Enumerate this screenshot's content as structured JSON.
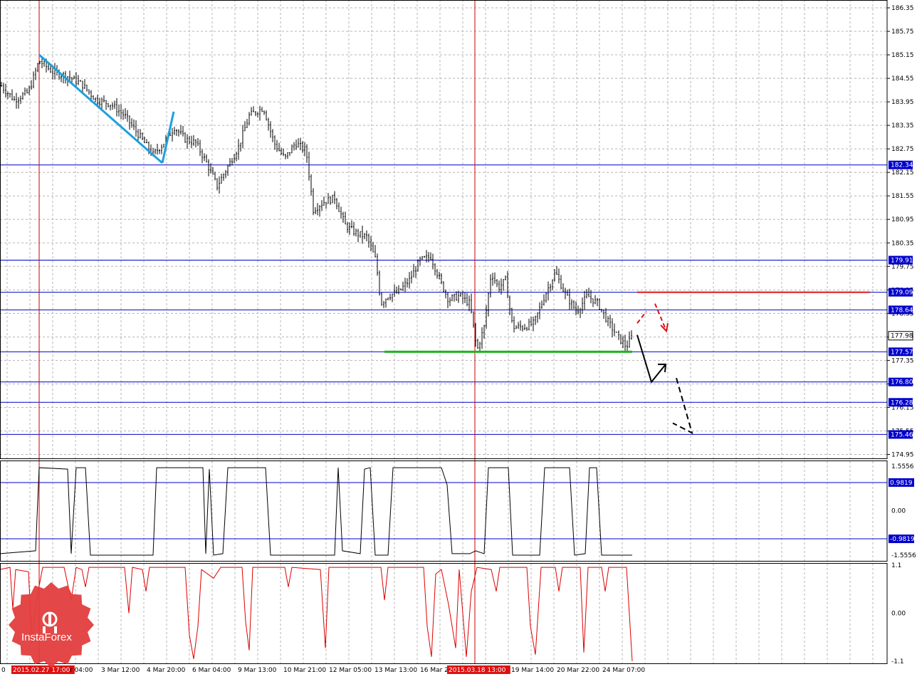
{
  "chart_data": {
    "type": "candlestick",
    "main_panel": {
      "price_scale": [
        186.35,
        185.75,
        185.15,
        184.55,
        183.95,
        183.35,
        182.75,
        182.15,
        181.55,
        180.95,
        180.35,
        179.75,
        179.15,
        178.55,
        177.95,
        177.35,
        176.75,
        176.15,
        175.55,
        174.95
      ],
      "ylim": [
        174.85,
        186.55
      ],
      "levels": [
        {
          "value": 182.34,
          "label": "182.34"
        },
        {
          "value": 179.91,
          "label": "179.91"
        },
        {
          "value": 179.09,
          "label": "179.09"
        },
        {
          "value": 178.64,
          "label": "178.64"
        },
        {
          "value": 177.57,
          "label": "177.57"
        },
        {
          "value": 176.8,
          "label": "176.80"
        },
        {
          "value": 176.28,
          "label": "176.28"
        },
        {
          "value": 175.46,
          "label": "175.46"
        }
      ],
      "current_price": "177.98",
      "close_path": [
        [
          0,
          184.4
        ],
        [
          20,
          184.0
        ],
        [
          40,
          184.2
        ],
        [
          55,
          185.0
        ],
        [
          75,
          184.7
        ],
        [
          95,
          184.6
        ],
        [
          115,
          184.4
        ],
        [
          135,
          184.0
        ],
        [
          155,
          183.9
        ],
        [
          175,
          183.6
        ],
        [
          195,
          183.1
        ],
        [
          215,
          182.6
        ],
        [
          230,
          182.9
        ],
        [
          245,
          183.3
        ],
        [
          260,
          183.0
        ],
        [
          275,
          182.9
        ],
        [
          290,
          182.4
        ],
        [
          305,
          181.8
        ],
        [
          320,
          182.3
        ],
        [
          335,
          182.8
        ],
        [
          350,
          183.6
        ],
        [
          370,
          183.8
        ],
        [
          385,
          182.9
        ],
        [
          400,
          182.5
        ],
        [
          415,
          182.9
        ],
        [
          430,
          182.7
        ],
        [
          440,
          181.2
        ],
        [
          455,
          181.4
        ],
        [
          470,
          181.5
        ],
        [
          485,
          180.8
        ],
        [
          500,
          180.6
        ],
        [
          515,
          180.5
        ],
        [
          528,
          179.9
        ],
        [
          535,
          178.8
        ],
        [
          545,
          179.0
        ],
        [
          560,
          179.1
        ],
        [
          575,
          179.4
        ],
        [
          590,
          179.9
        ],
        [
          605,
          180.0
        ],
        [
          620,
          179.3
        ],
        [
          630,
          178.9
        ],
        [
          645,
          179.0
        ],
        [
          660,
          178.8
        ],
        [
          670,
          177.6
        ],
        [
          680,
          178.2
        ],
        [
          690,
          179.6
        ],
        [
          700,
          179.2
        ],
        [
          710,
          179.4
        ],
        [
          720,
          178.2
        ],
        [
          735,
          178.2
        ],
        [
          750,
          178.3
        ],
        [
          765,
          179.0
        ],
        [
          780,
          179.6
        ],
        [
          795,
          179.0
        ],
        [
          810,
          178.6
        ],
        [
          825,
          179.0
        ],
        [
          840,
          178.8
        ],
        [
          855,
          178.3
        ],
        [
          870,
          177.9
        ],
        [
          880,
          177.7
        ],
        [
          888,
          177.98
        ]
      ],
      "annotations": {
        "blue_lines": [
          [
            [
              55,
              185.15
            ],
            [
              228,
              182.39
            ]
          ],
          [
            [
              228,
              182.39
            ],
            [
              244,
              183.7
            ]
          ]
        ],
        "green_support": [
          [
            540,
            177.57
          ],
          [
            888,
            177.57
          ]
        ],
        "red_resistance": [
          [
            895,
            179.09
          ],
          [
            1222,
            179.09
          ]
        ],
        "red_dashed_arrows": [
          [
            [
              895,
              178.3
            ],
            [
              908,
              178.6
            ]
          ],
          [
            [
              920,
              178.8
            ],
            [
              936,
              178.1
            ]
          ]
        ],
        "black_solid_arrow": [
          [
            895,
            178.0
          ],
          [
            915,
            176.8
          ],
          [
            935,
            177.25
          ]
        ],
        "black_dashed_arrow": [
          [
            950,
            176.9
          ],
          [
            972,
            175.5
          ],
          [
            945,
            175.75
          ]
        ]
      }
    },
    "osc1": {
      "scale": [
        "1.5556",
        "0.00",
        "-1.5556"
      ],
      "levels": [
        {
          "value": 0.9819,
          "label": "0.9819"
        },
        {
          "value": -0.9819,
          "label": "-0.9819"
        }
      ],
      "ylim": [
        -1.75,
        1.75
      ],
      "series": [
        [
          0,
          -1.5
        ],
        [
          50,
          -1.4
        ],
        [
          55,
          1.5
        ],
        [
          95,
          1.45
        ],
        [
          100,
          -1.5
        ],
        [
          107,
          1.5
        ],
        [
          120,
          1.5
        ],
        [
          127,
          -1.55
        ],
        [
          215,
          -1.55
        ],
        [
          220,
          1.5
        ],
        [
          285,
          1.5
        ],
        [
          289,
          -1.5
        ],
        [
          294,
          1.45
        ],
        [
          300,
          -1.55
        ],
        [
          313,
          -1.5
        ],
        [
          320,
          1.5
        ],
        [
          373,
          1.5
        ],
        [
          380,
          -1.55
        ],
        [
          470,
          -1.55
        ],
        [
          475,
          1.5
        ],
        [
          481,
          -1.4
        ],
        [
          506,
          -1.5
        ],
        [
          512,
          1.45
        ],
        [
          520,
          1.5
        ],
        [
          527,
          -1.55
        ],
        [
          545,
          -1.55
        ],
        [
          552,
          1.5
        ],
        [
          620,
          1.5
        ],
        [
          628,
          0.9
        ],
        [
          635,
          -1.5
        ],
        [
          660,
          -1.5
        ],
        [
          668,
          -1.4
        ],
        [
          680,
          -1.5
        ],
        [
          686,
          1.5
        ],
        [
          714,
          1.5
        ],
        [
          720,
          -1.55
        ],
        [
          758,
          -1.55
        ],
        [
          765,
          1.5
        ],
        [
          800,
          1.5
        ],
        [
          807,
          -1.55
        ],
        [
          822,
          -1.5
        ],
        [
          828,
          1.5
        ],
        [
          838,
          1.5
        ],
        [
          845,
          -1.55
        ],
        [
          888,
          -1.55
        ]
      ]
    },
    "osc2": {
      "scale": [
        "1.1",
        "0.00",
        "-1.1"
      ],
      "ylim": [
        -1.15,
        1.15
      ],
      "series": [
        [
          0,
          1.0
        ],
        [
          14,
          1.05
        ],
        [
          18,
          0.1
        ],
        [
          22,
          1.0
        ],
        [
          40,
          0.95
        ],
        [
          45,
          -0.7
        ],
        [
          50,
          0.2
        ],
        [
          60,
          1.05
        ],
        [
          90,
          1.05
        ],
        [
          100,
          0.3
        ],
        [
          107,
          1.05
        ],
        [
          115,
          1.0
        ],
        [
          120,
          0.6
        ],
        [
          125,
          1.05
        ],
        [
          175,
          1.05
        ],
        [
          181,
          0.0
        ],
        [
          186,
          1.05
        ],
        [
          200,
          1.0
        ],
        [
          205,
          0.5
        ],
        [
          210,
          1.05
        ],
        [
          260,
          1.05
        ],
        [
          266,
          -0.5
        ],
        [
          272,
          -1.05
        ],
        [
          278,
          -0.3
        ],
        [
          283,
          1.0
        ],
        [
          300,
          0.8
        ],
        [
          310,
          1.05
        ],
        [
          340,
          1.05
        ],
        [
          345,
          -0.2
        ],
        [
          350,
          -0.85
        ],
        [
          355,
          1.05
        ],
        [
          400,
          1.05
        ],
        [
          405,
          0.6
        ],
        [
          410,
          1.05
        ],
        [
          450,
          1.0
        ],
        [
          457,
          -0.8
        ],
        [
          462,
          1.05
        ],
        [
          535,
          1.05
        ],
        [
          540,
          0.3
        ],
        [
          545,
          1.05
        ],
        [
          595,
          1.05
        ],
        [
          600,
          -0.3
        ],
        [
          606,
          -1.0
        ],
        [
          612,
          0.9
        ],
        [
          620,
          1.0
        ],
        [
          630,
          0.2
        ],
        [
          640,
          -0.8
        ],
        [
          645,
          1.0
        ],
        [
          655,
          -1.0
        ],
        [
          662,
          0.5
        ],
        [
          670,
          1.05
        ],
        [
          690,
          1.0
        ],
        [
          697,
          0.5
        ],
        [
          702,
          1.05
        ],
        [
          740,
          1.05
        ],
        [
          745,
          -0.3
        ],
        [
          752,
          -0.95
        ],
        [
          760,
          1.05
        ],
        [
          780,
          1.05
        ],
        [
          785,
          0.5
        ],
        [
          790,
          1.05
        ],
        [
          815,
          1.05
        ],
        [
          820,
          -0.9
        ],
        [
          826,
          1.05
        ],
        [
          845,
          1.05
        ],
        [
          850,
          0.5
        ],
        [
          855,
          1.05
        ],
        [
          880,
          1.05
        ],
        [
          888,
          -1.1
        ]
      ]
    },
    "time_labels": [
      "0",
      "2015.02.27 17:00",
      "r 04:00",
      "3 Mar 12:00",
      "4 Mar 20:00",
      "6 Mar 04:00",
      "9 Mar 13:00",
      "10 Mar 21:00",
      "12 Mar 05:00",
      "13 Mar 13:00",
      "16 Mar 2",
      "2015.03.18 13:00",
      "19 Mar 14:00",
      "20 Mar 22:00",
      "24 Mar 07:00"
    ],
    "logo_text": "InstaForex",
    "colors": {
      "grid": "#b4b4b4",
      "level": "#0000cc",
      "label_bg": "#0000cc",
      "current_bg": "#ffffff",
      "vertical_marker": "#cc0000",
      "blue_trend": "#1ea0dc",
      "green_support": "#19b419",
      "red_resistance": "#dd1111",
      "osc2_line": "#dd0000",
      "logo": "#e33d3d"
    }
  }
}
